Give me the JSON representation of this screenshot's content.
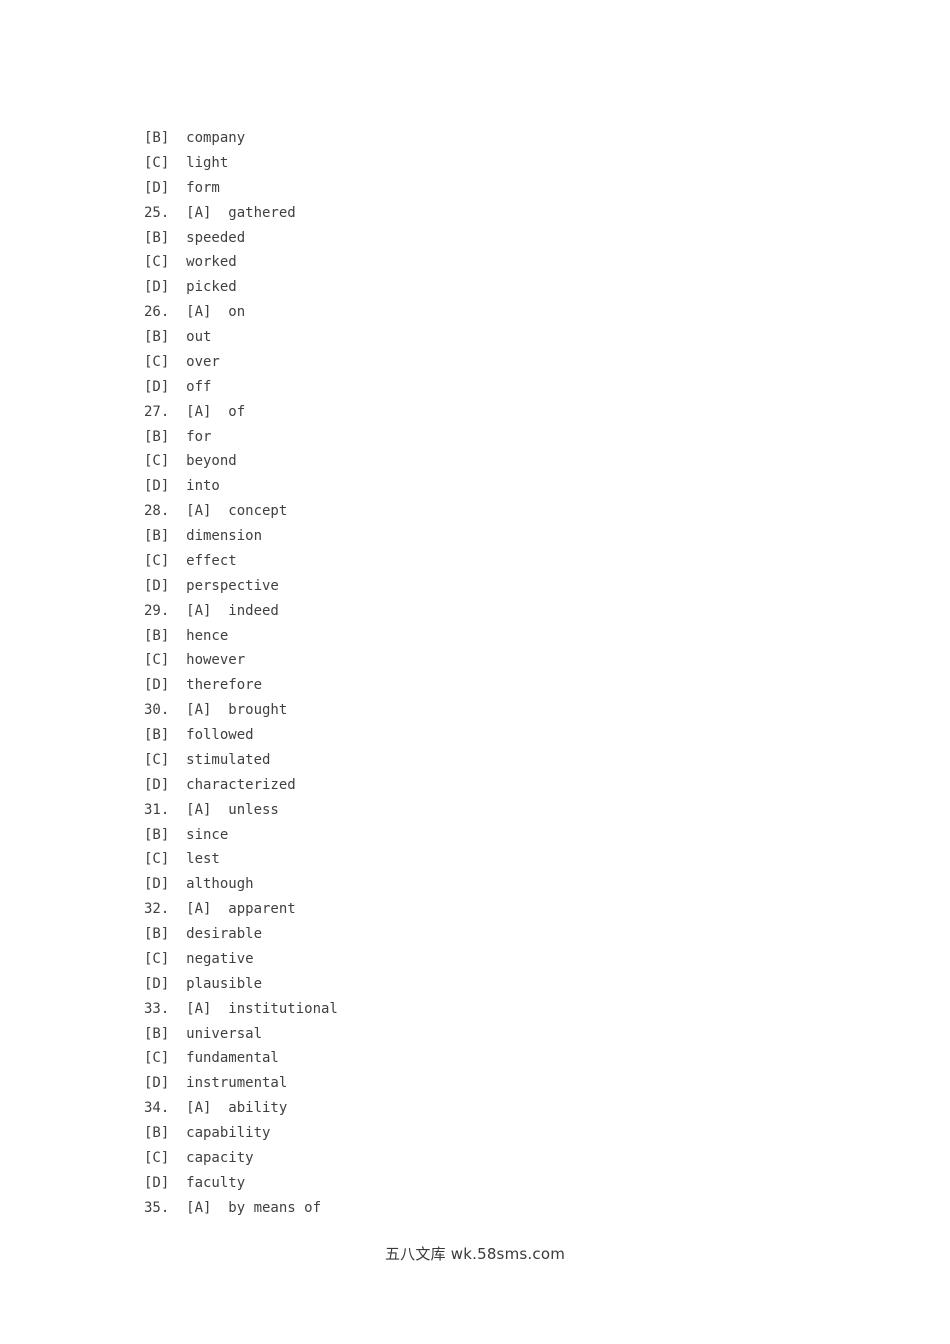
{
  "document": {
    "type": "exam-answer-options",
    "background_color": "#ffffff",
    "text_color": "#404040",
    "lines": [
      "[B]  company",
      "[C]  light",
      "[D]  form",
      "25.  [A]  gathered",
      "[B]  speeded",
      "[C]  worked",
      "[D]  picked",
      "26.  [A]  on",
      "[B]  out",
      "[C]  over",
      "[D]  off",
      "27.  [A]  of",
      "[B]  for",
      "[C]  beyond",
      "[D]  into",
      "28.  [A]  concept",
      "[B]  dimension",
      "[C]  effect",
      "[D]  perspective",
      "29.  [A]  indeed",
      "[B]  hence",
      "[C]  however",
      "[D]  therefore",
      "30.  [A]  brought",
      "[B]  followed",
      "[C]  stimulated",
      "[D]  characterized",
      "31.  [A]  unless",
      "[B]  since",
      "[C]  lest",
      "[D]  although",
      "32.  [A]  apparent",
      "[B]  desirable",
      "[C]  negative",
      "[D]  plausible",
      "33.  [A]  institutional",
      "[B]  universal",
      "[C]  fundamental",
      "[D]  instrumental",
      "34.  [A]  ability",
      "[B]  capability",
      "[C]  capacity",
      "[D]  faculty",
      "35.  [A]  by means of"
    ]
  },
  "watermark": {
    "text": "五八文库 wk.58sms.com",
    "color": "#3a3a3a"
  }
}
